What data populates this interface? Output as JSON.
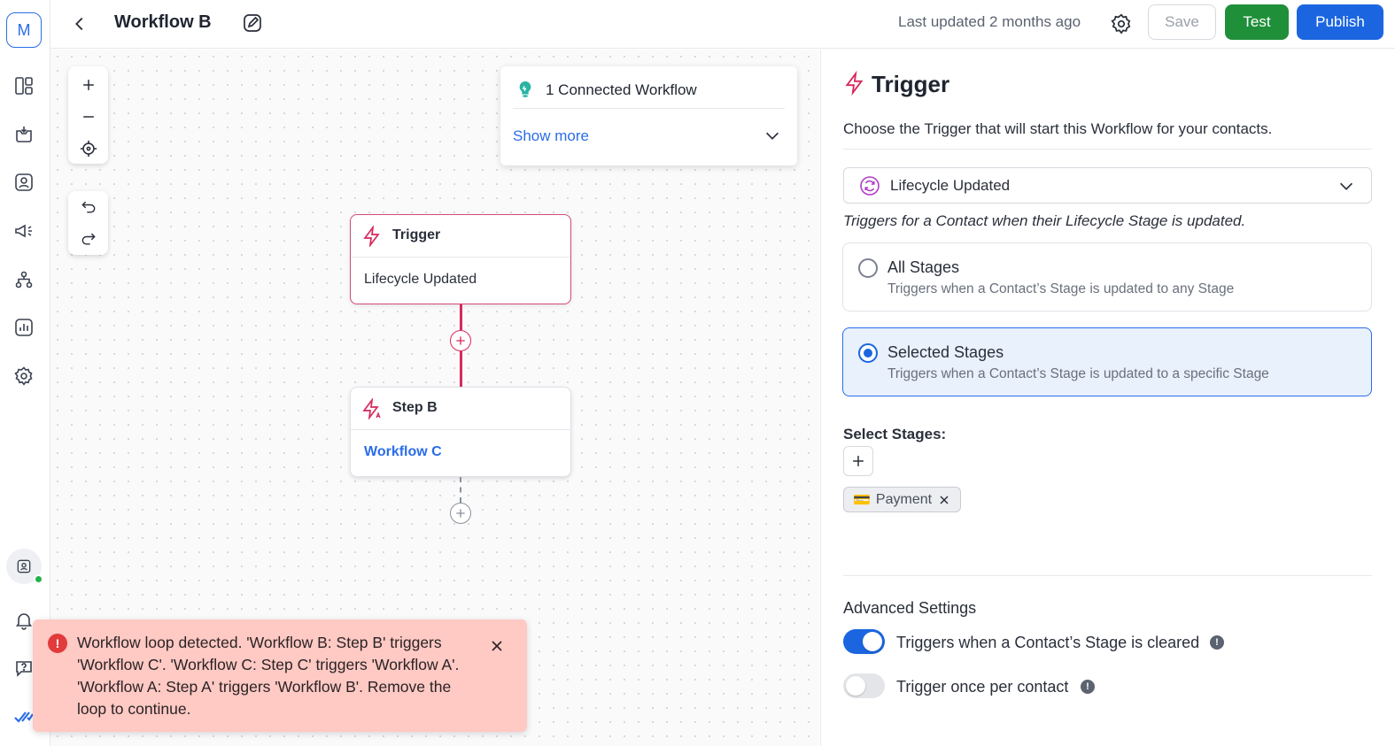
{
  "rail": {
    "avatar_letter": "M",
    "icons": [
      "layout-icon",
      "inbox-icon",
      "contacts-icon",
      "broadcast-icon",
      "workflow-icon",
      "reports-icon",
      "settings-icon"
    ],
    "bottom_icons": [
      "status-icon",
      "bell-icon",
      "help-icon",
      "brand-check-icon"
    ]
  },
  "header": {
    "title": "Workflow B",
    "updated": "Last updated 2 months ago",
    "save_label": "Save",
    "test_label": "Test",
    "publish_label": "Publish"
  },
  "canvas": {
    "connected": {
      "title": "1 Connected Workflow",
      "show_more": "Show more"
    },
    "trigger_node": {
      "title": "Trigger",
      "value": "Lifecycle Updated"
    },
    "step_node": {
      "title": "Step B",
      "value": "Workflow C"
    }
  },
  "toast": {
    "message": "Workflow loop detected. 'Workflow B: Step B' triggers 'Workflow C'. 'Workflow C: Step C' triggers 'Workflow A'. 'Workflow A: Step A' triggers 'Workflow B'. Remove the loop to continue."
  },
  "panel": {
    "title": "Trigger",
    "description": "Choose the Trigger that will start this Workflow for your contacts.",
    "select_value": "Lifecycle Updated",
    "hint": "Triggers for a Contact when their Lifecycle Stage is updated.",
    "options": [
      {
        "title": "All Stages",
        "desc": "Triggers when a Contact’s Stage is updated to any Stage",
        "selected": false
      },
      {
        "title": "Selected Stages",
        "desc": "Triggers when a Contact’s Stage is updated to a specific Stage",
        "selected": true
      }
    ],
    "select_stages_label": "Select Stages:",
    "chip": {
      "emoji": "💳",
      "label": "Payment"
    },
    "advanced_label": "Advanced Settings",
    "toggles": [
      {
        "label": "Triggers when a Contact’s Stage is cleared",
        "on": true
      },
      {
        "label": "Trigger once per contact",
        "on": false
      }
    ]
  },
  "colors": {
    "accent_blue": "#1b66e0",
    "test_green": "#1f8f3a",
    "trigger_pink": "#d8285c",
    "toast_bg": "#ffc9c4"
  }
}
